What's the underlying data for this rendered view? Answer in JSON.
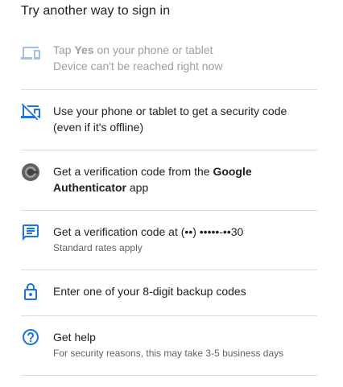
{
  "header": {
    "title": "Try another way to sign in"
  },
  "options": [
    {
      "pre": "Tap ",
      "bold": "Yes",
      "post": " on your phone or tablet",
      "secondary": "Device can't be reached right now",
      "icon": "devices-icon"
    },
    {
      "text": "Use your phone or tablet to get a security code (even if it's offline)",
      "icon": "phonelink-off-icon"
    },
    {
      "pre": "Get a verification code from the ",
      "bold": "Google Authenticator",
      "post": " app",
      "icon": "authenticator-icon"
    },
    {
      "text": "Get a verification code at (••) •••••-••30",
      "secondary": "Standard rates apply",
      "icon": "sms-icon"
    },
    {
      "text": "Enter one of your 8-digit backup codes",
      "icon": "lock-icon"
    },
    {
      "text": "Get help",
      "secondary": "For security reasons, this may take 3-5 business days",
      "icon": "help-icon"
    }
  ],
  "colors": {
    "accent": "#1a73e8",
    "divider": "#dadce0",
    "text": "#202124",
    "secondary": "#5f6368",
    "disabled": "#9aa0a6"
  }
}
